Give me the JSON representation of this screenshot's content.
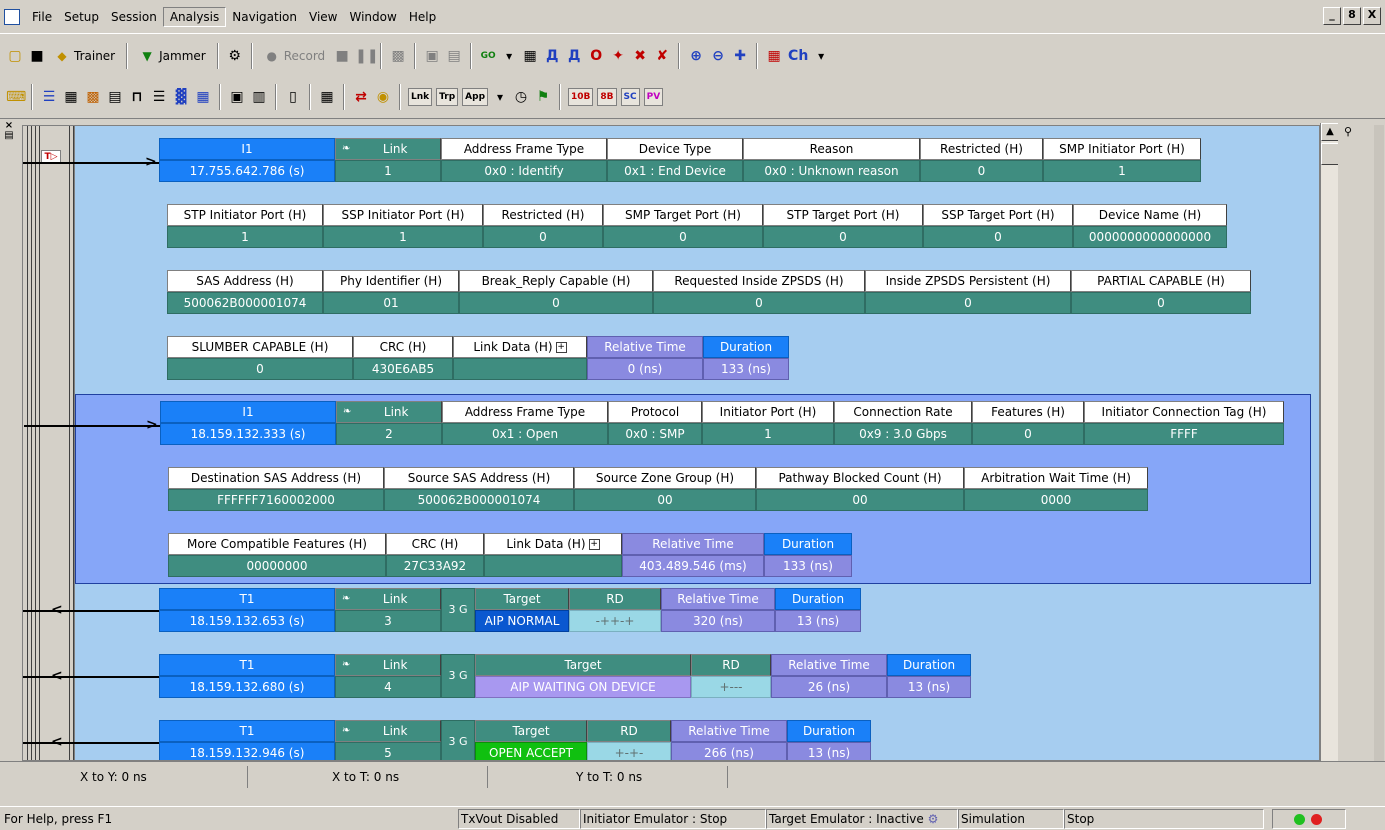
{
  "menu": {
    "items": [
      "File",
      "Setup",
      "Session",
      "Analysis",
      "Navigation",
      "View",
      "Window",
      "Help"
    ],
    "active": "Analysis"
  },
  "window_buttons": [
    "_",
    "8",
    "X"
  ],
  "toolbar1": {
    "trainer": "Trainer",
    "jammer": "Jammer",
    "record": "Record"
  },
  "toolbar2": {
    "tags": [
      "Lnk",
      "Trp",
      "App"
    ],
    "b10": "10B",
    "b8": "8B",
    "sc": "SC",
    "pv": "PV"
  },
  "icons": {
    "open": "folder-open-icon",
    "save": "save-icon",
    "trainer": "trainer-diamond-icon",
    "jammer": "jammer-triangle-icon",
    "search": "binoculars-icon",
    "zoom_in": "zoom-in-icon",
    "zoom_out": "zoom-out-icon",
    "marker": "trigger-marker-icon"
  },
  "colors": {
    "header_blue": "#1a80f8",
    "value_teal": "#3f8d80",
    "relative_purple": "#8a8ae0",
    "pane_bg": "#a6cdf0",
    "selected_pkt": "#86a6f8",
    "open_accept_green": "#10c010"
  },
  "packets": [
    {
      "id": "p1",
      "rows": [
        [
          {
            "h": "I1",
            "v": "17.755.642.786 (s)",
            "hc": "blue",
            "vc": "blue"
          },
          {
            "h": "Link",
            "v": "1",
            "hc": "teal",
            "link": true
          },
          {
            "h": "Address Frame Type",
            "v": "0x0 : Identify"
          },
          {
            "h": "Device Type",
            "v": "0x1 : End Device"
          },
          {
            "h": "Reason",
            "v": "0x0 : Unknown reason"
          },
          {
            "h": "Restricted (H)",
            "v": "0"
          },
          {
            "h": "SMP Initiator Port (H)",
            "v": "1"
          }
        ],
        [
          {
            "h": "STP Initiator Port (H)",
            "v": "1"
          },
          {
            "h": "SSP Initiator Port (H)",
            "v": "1"
          },
          {
            "h": "Restricted (H)",
            "v": "0"
          },
          {
            "h": "SMP Target Port (H)",
            "v": "0"
          },
          {
            "h": "STP Target Port (H)",
            "v": "0"
          },
          {
            "h": "SSP Target Port (H)",
            "v": "0"
          },
          {
            "h": "Device Name (H)",
            "v": "0000000000000000"
          }
        ],
        [
          {
            "h": "SAS Address (H)",
            "v": "500062B000001074"
          },
          {
            "h": "Phy Identifier (H)",
            "v": "01"
          },
          {
            "h": "Break_Reply Capable (H)",
            "v": "0"
          },
          {
            "h": "Requested Inside ZPSDS (H)",
            "v": "0"
          },
          {
            "h": "Inside ZPSDS Persistent (H)",
            "v": "0"
          },
          {
            "h": "PARTIAL CAPABLE (H)",
            "v": "0"
          }
        ],
        [
          {
            "h": "SLUMBER CAPABLE (H)",
            "v": "0"
          },
          {
            "h": "CRC (H)",
            "v": "430E6AB5"
          },
          {
            "h": "Link Data (H)",
            "v": "",
            "expand": true
          },
          {
            "h": "Relative Time",
            "v": "0 (ns)",
            "hc": "purple",
            "vc": "purple"
          },
          {
            "h": "Duration",
            "v": "133 (ns)",
            "hc": "blue",
            "vc": "purple"
          }
        ]
      ]
    },
    {
      "id": "p2",
      "rows": [
        [
          {
            "h": "I1",
            "v": "18.159.132.333 (s)",
            "hc": "blue",
            "vc": "blue"
          },
          {
            "h": "Link",
            "v": "2",
            "hc": "teal",
            "link": true
          },
          {
            "h": "Address Frame Type",
            "v": "0x1 : Open"
          },
          {
            "h": "Protocol",
            "v": "0x0 : SMP"
          },
          {
            "h": "Initiator Port (H)",
            "v": "1"
          },
          {
            "h": "Connection Rate",
            "v": "0x9 : 3.0 Gbps"
          },
          {
            "h": "Features (H)",
            "v": "0"
          },
          {
            "h": "Initiator Connection Tag (H)",
            "v": "FFFF"
          }
        ],
        [
          {
            "h": "Destination SAS Address (H)",
            "v": "FFFFFF7160002000"
          },
          {
            "h": "Source SAS Address (H)",
            "v": "500062B000001074"
          },
          {
            "h": "Source Zone Group (H)",
            "v": "00"
          },
          {
            "h": "Pathway Blocked Count (H)",
            "v": "00"
          },
          {
            "h": "Arbitration Wait Time (H)",
            "v": "0000"
          }
        ],
        [
          {
            "h": "More Compatible Features (H)",
            "v": "00000000"
          },
          {
            "h": "CRC (H)",
            "v": "27C33A92"
          },
          {
            "h": "Link Data (H)",
            "v": "",
            "expand": true
          },
          {
            "h": "Relative Time",
            "v": "403.489.546 (ms)",
            "hc": "purple",
            "vc": "purple"
          },
          {
            "h": "Duration",
            "v": "133 (ns)",
            "hc": "blue",
            "vc": "purple"
          }
        ]
      ]
    },
    {
      "id": "p3",
      "rows": [
        [
          {
            "h": "T1",
            "v": "18.159.132.653 (s)",
            "hc": "blue",
            "vc": "blue"
          },
          {
            "h": "Link",
            "v": "3",
            "hc": "teal",
            "link": true
          },
          {
            "g": "3 G"
          },
          {
            "h": "Target",
            "v": "AIP NORMAL",
            "hc": "teal",
            "vc": "navyblue"
          },
          {
            "h": "RD",
            "v": "-++-+",
            "hc": "teal",
            "vc": "cyan"
          },
          {
            "h": "Relative Time",
            "v": "320 (ns)",
            "hc": "purple",
            "vc": "purple"
          },
          {
            "h": "Duration",
            "v": "13 (ns)",
            "hc": "blue",
            "vc": "purple"
          }
        ]
      ]
    },
    {
      "id": "p4",
      "rows": [
        [
          {
            "h": "T1",
            "v": "18.159.132.680 (s)",
            "hc": "blue",
            "vc": "blue"
          },
          {
            "h": "Link",
            "v": "4",
            "hc": "teal",
            "link": true
          },
          {
            "g": "3 G"
          },
          {
            "h": "Target",
            "v": "AIP WAITING ON DEVICE",
            "hc": "teal",
            "vc": "lavender"
          },
          {
            "h": "RD",
            "v": "+---",
            "hc": "teal",
            "vc": "cyan"
          },
          {
            "h": "Relative Time",
            "v": "26 (ns)",
            "hc": "purple",
            "vc": "purple"
          },
          {
            "h": "Duration",
            "v": "13 (ns)",
            "hc": "blue",
            "vc": "purple"
          }
        ]
      ]
    },
    {
      "id": "p5",
      "rows": [
        [
          {
            "h": "T1",
            "v": "18.159.132.946 (s)",
            "hc": "blue",
            "vc": "blue"
          },
          {
            "h": "Link",
            "v": "5",
            "hc": "teal",
            "link": true
          },
          {
            "g": "3 G"
          },
          {
            "h": "Target",
            "v": "OPEN ACCEPT",
            "hc": "teal",
            "vc": "green"
          },
          {
            "h": "RD",
            "v": "+-+-",
            "hc": "teal",
            "vc": "cyan"
          },
          {
            "h": "Relative Time",
            "v": "266 (ns)",
            "hc": "purple",
            "vc": "purple"
          },
          {
            "h": "Duration",
            "v": "13 (ns)",
            "hc": "blue",
            "vc": "purple"
          }
        ]
      ]
    }
  ],
  "timebar": {
    "x_to_y": "X to Y: 0 ns",
    "x_to_t": "X to T: 0 ns",
    "y_to_t": "Y to T: 0 ns"
  },
  "status": {
    "help": "For Help, press F1",
    "txvout": "TxVout Disabled",
    "initiator": "Initiator Emulator : Stop",
    "target": "Target Emulator : Inactive",
    "simulation": "Simulation",
    "stop": "Stop"
  }
}
